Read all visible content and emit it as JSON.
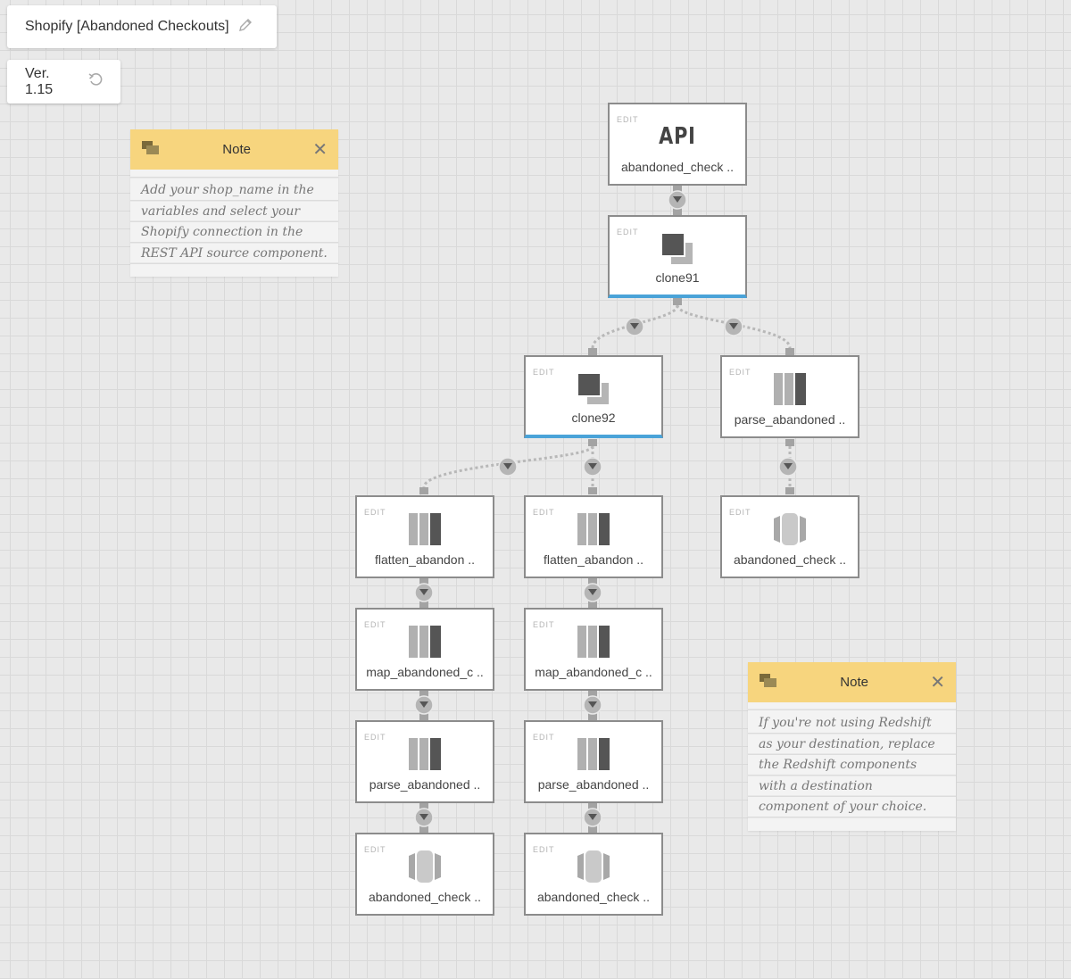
{
  "header": {
    "title": "Shopify [Abandoned Checkouts]",
    "version": "Ver. 1.15",
    "edit_icon": "pencil-icon",
    "revert_icon": "revert-icon"
  },
  "notes": [
    {
      "title": "Note",
      "text": "Add your shop_name in the variables and select your Shopify connection in the REST API source component."
    },
    {
      "title": "Note",
      "text": "If you're not using Redshift as your destination, replace the Redshift components with a destination component of your choice."
    }
  ],
  "colors": {
    "note_header": "#f7d57e",
    "selected_accent": "#4aa3d8",
    "node_border": "#8c8c8c"
  },
  "nodes": {
    "api": {
      "edit": "EDIT",
      "label": "abandoned_check ..",
      "icon": "API"
    },
    "clone91": {
      "edit": "EDIT",
      "label": "clone91",
      "icon": "clone-icon"
    },
    "clone92": {
      "edit": "EDIT",
      "label": "clone92",
      "icon": "clone-icon"
    },
    "parse_right": {
      "edit": "EDIT",
      "label": "parse_abandoned ..",
      "icon": "transform-icon"
    },
    "dest_right": {
      "edit": "EDIT",
      "label": "abandoned_check ..",
      "icon": "redshift-icon"
    },
    "flatten_left": {
      "edit": "EDIT",
      "label": "flatten_abandon ..",
      "icon": "transform-icon"
    },
    "flatten_mid": {
      "edit": "EDIT",
      "label": "flatten_abandon ..",
      "icon": "transform-icon"
    },
    "map_left": {
      "edit": "EDIT",
      "label": "map_abandoned_c ..",
      "icon": "transform-icon"
    },
    "map_mid": {
      "edit": "EDIT",
      "label": "map_abandoned_c ..",
      "icon": "transform-icon"
    },
    "parse_left": {
      "edit": "EDIT",
      "label": "parse_abandoned ..",
      "icon": "transform-icon"
    },
    "parse_mid": {
      "edit": "EDIT",
      "label": "parse_abandoned ..",
      "icon": "transform-icon"
    },
    "dest_left": {
      "edit": "EDIT",
      "label": "abandoned_check ..",
      "icon": "redshift-icon"
    },
    "dest_mid": {
      "edit": "EDIT",
      "label": "abandoned_check ..",
      "icon": "redshift-icon"
    }
  }
}
